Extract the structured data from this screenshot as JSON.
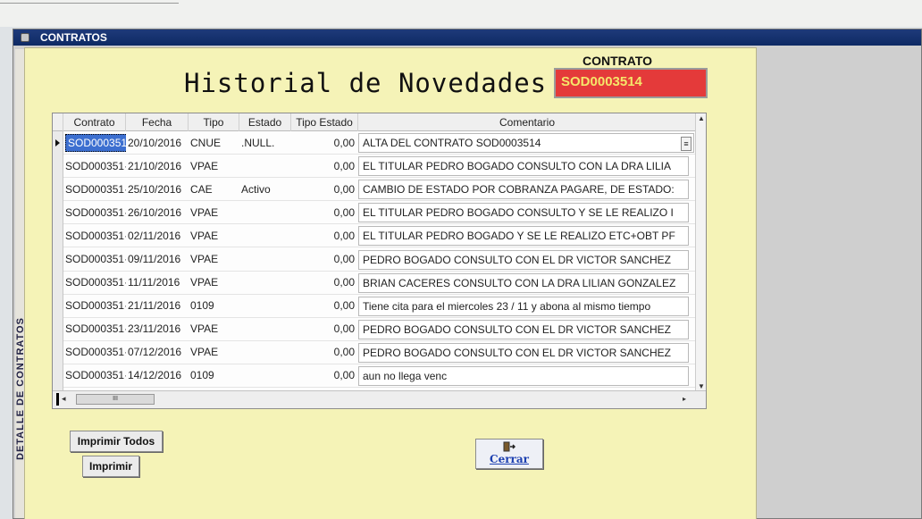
{
  "window": {
    "title": "CONTRATOS",
    "side_label": "DETALLE DE CONTRATOS"
  },
  "main": {
    "heading": "Historial de Novedades",
    "contrato_label": "CONTRATO",
    "contrato_value": "SOD0003514"
  },
  "grid": {
    "columns": [
      "Contrato",
      "Fecha",
      "Tipo",
      "Estado",
      "Tipo Estado",
      "Comentario"
    ],
    "rows": [
      {
        "contrato": "SOD000351",
        "fecha": "20/10/2016",
        "tipo": "CNUE",
        "estado": ".NULL.",
        "tipo_estado": "0,00",
        "comentario": "ALTA DEL CONTRATO  SOD0003514"
      },
      {
        "contrato": "SOD000351·",
        "fecha": "21/10/2016",
        "tipo": "VPAE",
        "estado": "",
        "tipo_estado": "0,00",
        "comentario": "EL TITULAR PEDRO BOGADO CONSULTO CON LA DRA LILIA"
      },
      {
        "contrato": "SOD000351·",
        "fecha": "25/10/2016",
        "tipo": "CAE",
        "estado": "Activo",
        "tipo_estado": "0,00",
        "comentario": "CAMBIO DE ESTADO POR COBRANZA PAGARE, DE ESTADO:"
      },
      {
        "contrato": "SOD000351·",
        "fecha": "26/10/2016",
        "tipo": "VPAE",
        "estado": "",
        "tipo_estado": "0,00",
        "comentario": "EL TITULAR PEDRO BOGADO CONSULTO Y SE LE REALIZO I"
      },
      {
        "contrato": "SOD000351·",
        "fecha": "02/11/2016",
        "tipo": "VPAE",
        "estado": "",
        "tipo_estado": "0,00",
        "comentario": "EL TITULAR PEDRO BOGADO Y SE LE REALIZO ETC+OBT PF"
      },
      {
        "contrato": "SOD000351·",
        "fecha": "09/11/2016",
        "tipo": "VPAE",
        "estado": "",
        "tipo_estado": "0,00",
        "comentario": "PEDRO BOGADO CONSULTO CON EL DR VICTOR SANCHEZ"
      },
      {
        "contrato": "SOD000351·",
        "fecha": "11/11/2016",
        "tipo": "VPAE",
        "estado": "",
        "tipo_estado": "0,00",
        "comentario": "BRIAN CACERES CONSULTO CON LA DRA LILIAN GONZALEZ"
      },
      {
        "contrato": "SOD000351·",
        "fecha": "21/11/2016",
        "tipo": "0109",
        "estado": "",
        "tipo_estado": "0,00",
        "comentario": "Tiene cita para el miercoles 23 / 11 y abona al mismo tiempo"
      },
      {
        "contrato": "SOD000351·",
        "fecha": "23/11/2016",
        "tipo": "VPAE",
        "estado": "",
        "tipo_estado": "0,00",
        "comentario": "PEDRO BOGADO CONSULTO CON EL DR VICTOR SANCHEZ"
      },
      {
        "contrato": "SOD000351·",
        "fecha": "07/12/2016",
        "tipo": "VPAE",
        "estado": "",
        "tipo_estado": "0,00",
        "comentario": "PEDRO BOGADO CONSULTO CON EL DR VICTOR SANCHEZ"
      },
      {
        "contrato": "SOD000351·",
        "fecha": "14/12/2016",
        "tipo": "0109",
        "estado": "",
        "tipo_estado": "0,00",
        "comentario": "aun no llega venc"
      }
    ],
    "hscroll_thumb_label": "III"
  },
  "buttons": {
    "print_all": "Imprimir Todos",
    "print": "Imprimir",
    "close": "Cerrar"
  },
  "colors": {
    "panel_bg": "#f5f3b7",
    "title_bar": "#0e2a64",
    "contrato_box": "#e43a3a",
    "contrato_text": "#f5e66a",
    "selection": "#3c6fd0",
    "close_link": "#1c3fb0"
  }
}
